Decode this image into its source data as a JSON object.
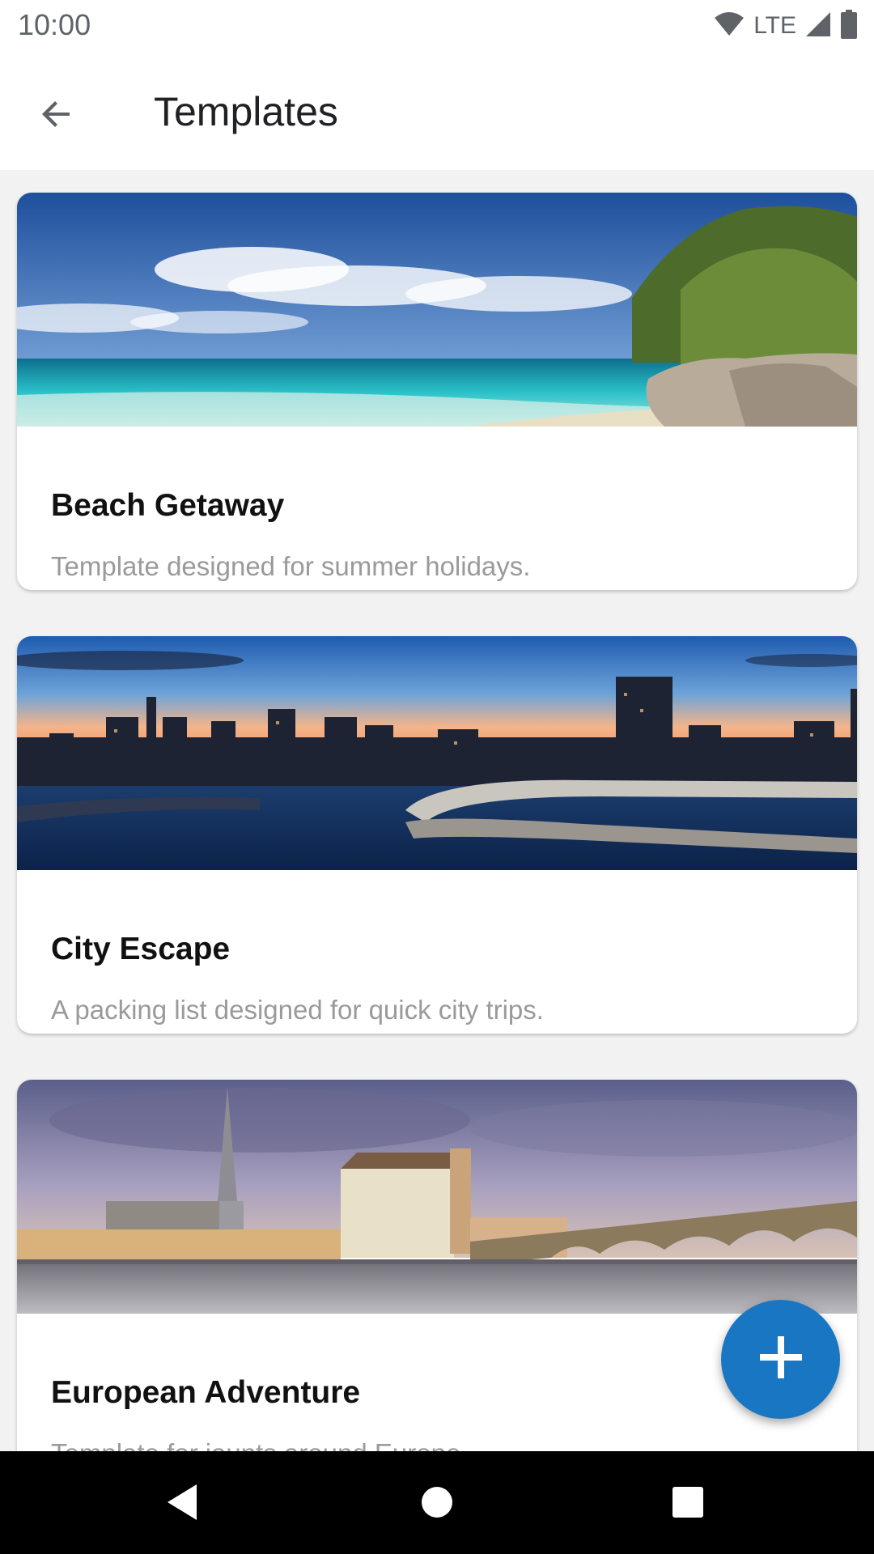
{
  "status_bar": {
    "time": "10:00",
    "network": "LTE",
    "icons": [
      "wifi-icon",
      "signal-icon",
      "battery-icon"
    ]
  },
  "app_bar": {
    "title": "Templates",
    "back_icon": "arrow-back-icon"
  },
  "templates": [
    {
      "title": "Beach Getaway",
      "description": "Template designed for summer holidays.",
      "image": "beach-photo"
    },
    {
      "title": "City Escape",
      "description": "A packing list designed for quick city trips.",
      "image": "city-skyline-photo"
    },
    {
      "title": "European Adventure",
      "description": "Template for jaunts around Europe.",
      "image": "european-town-photo"
    }
  ],
  "fab": {
    "icon": "plus-icon"
  },
  "nav_bar": {
    "icons": [
      "back-triangle-icon",
      "home-circle-icon",
      "recents-square-icon"
    ]
  },
  "colors": {
    "accent": "#1976c2",
    "background": "#f2f2f2",
    "title_text": "#202124",
    "secondary_text": "#9a9a9a"
  }
}
